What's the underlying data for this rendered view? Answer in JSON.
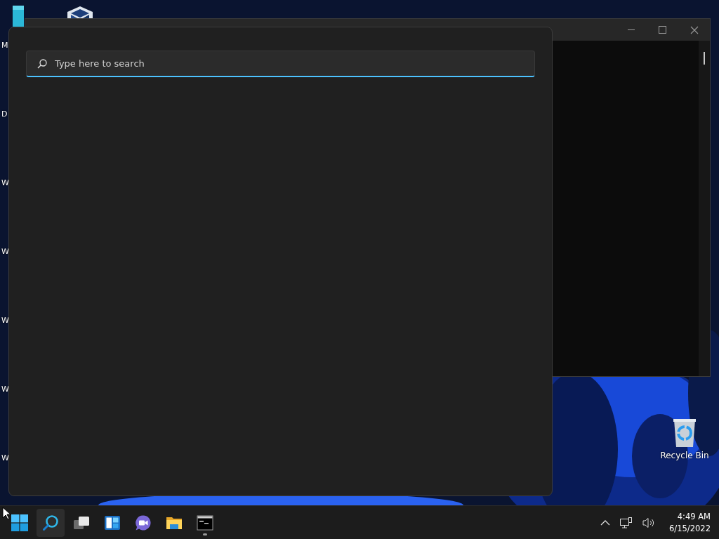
{
  "desktop": {
    "edge_labels": [
      "M",
      "D",
      "W",
      "W",
      "W",
      "W",
      "W"
    ],
    "recycle_bin": {
      "label": "Recycle Bin"
    }
  },
  "search_flyout": {
    "search": {
      "placeholder": "Type here to search"
    }
  },
  "taskbar": {
    "apps": [
      {
        "kind": "start",
        "selected": false,
        "running": false
      },
      {
        "kind": "search",
        "selected": true,
        "running": false
      },
      {
        "kind": "taskview",
        "selected": false,
        "running": false
      },
      {
        "kind": "widgets",
        "selected": false,
        "running": false
      },
      {
        "kind": "chat",
        "selected": false,
        "running": false
      },
      {
        "kind": "explorer",
        "selected": false,
        "running": false
      },
      {
        "kind": "terminal",
        "selected": false,
        "running": true
      }
    ],
    "clock": {
      "time": "4:49 AM",
      "date": "6/15/2022"
    }
  }
}
